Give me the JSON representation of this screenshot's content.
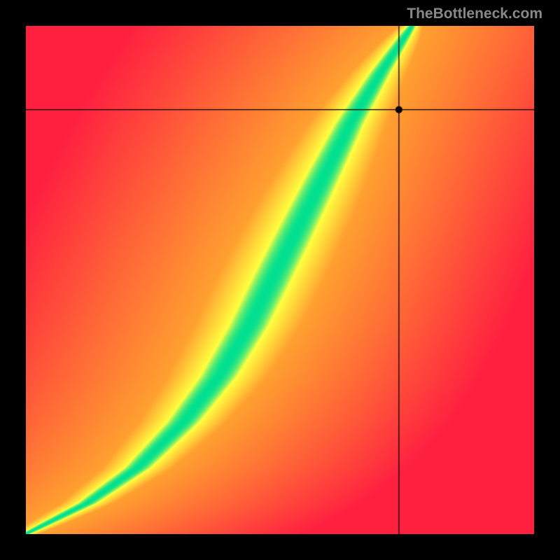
{
  "watermark": "TheBottleneck.com",
  "chart_data": {
    "type": "heatmap",
    "title": "",
    "xlabel": "",
    "ylabel": "",
    "xlim": [
      0,
      1
    ],
    "ylim": [
      0,
      1
    ],
    "marker": {
      "x": 0.735,
      "y": 0.835
    },
    "crosshair": {
      "x": 0.735,
      "y": 0.835
    },
    "ridge_curve": {
      "description": "Green optimal ridge from bottom-left to top; bows right in lower half then turns steeper",
      "points": [
        [
          0.0,
          0.0
        ],
        [
          0.12,
          0.06
        ],
        [
          0.22,
          0.13
        ],
        [
          0.31,
          0.22
        ],
        [
          0.38,
          0.31
        ],
        [
          0.44,
          0.41
        ],
        [
          0.49,
          0.51
        ],
        [
          0.54,
          0.61
        ],
        [
          0.59,
          0.71
        ],
        [
          0.64,
          0.81
        ],
        [
          0.7,
          0.91
        ],
        [
          0.76,
          1.0
        ]
      ]
    },
    "color_stops": {
      "ridge": "#00E090",
      "near": "#FFFF40",
      "mid": "#FFA030",
      "far": "#FF2040"
    }
  }
}
